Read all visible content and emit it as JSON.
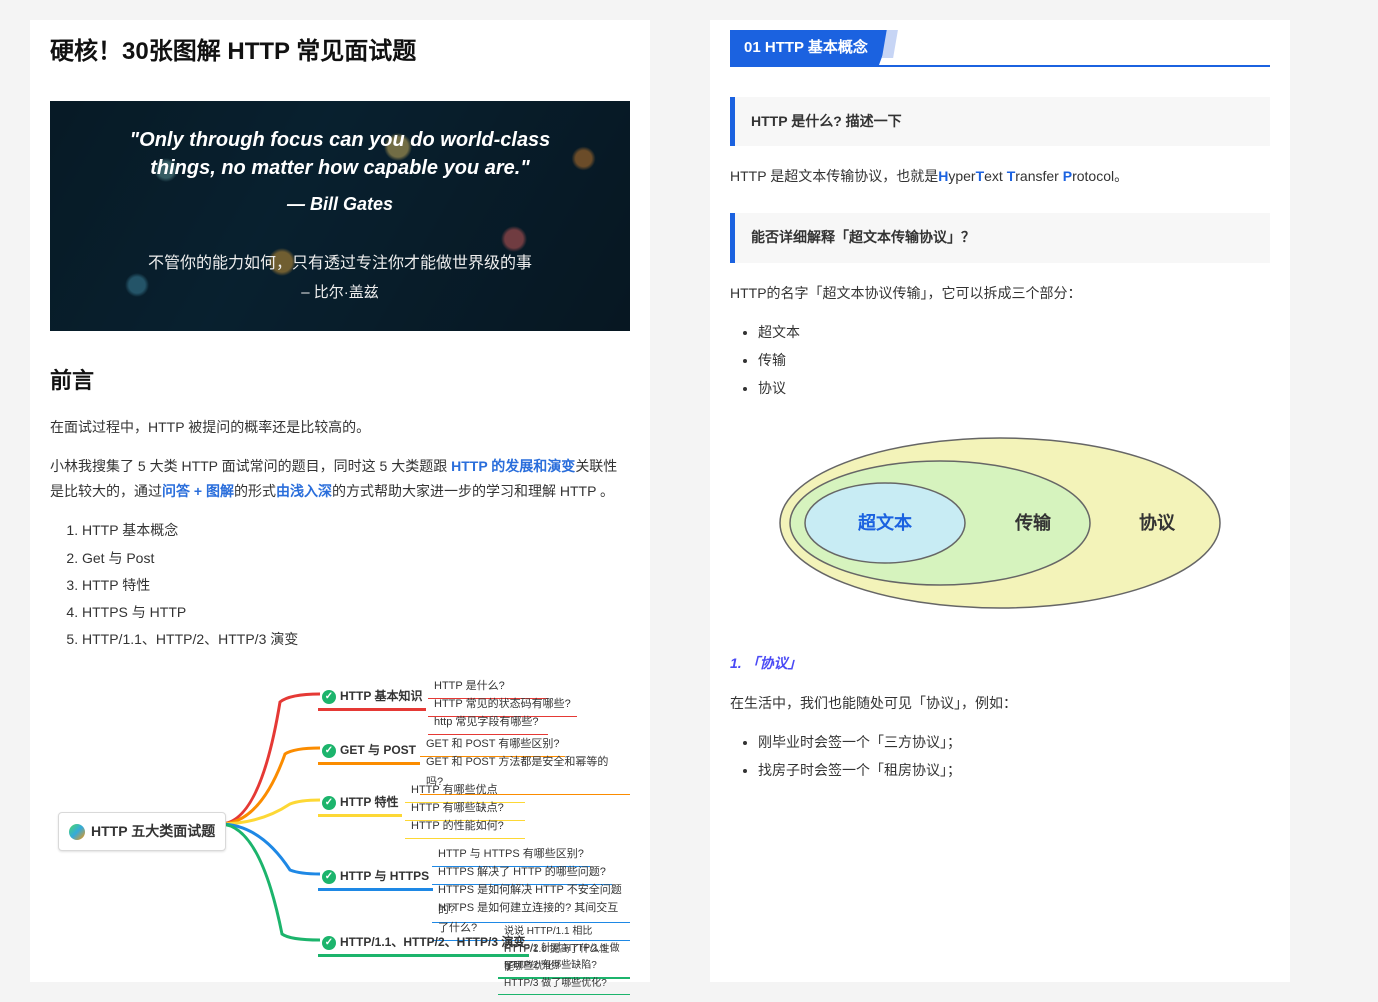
{
  "left": {
    "title": "硬核！30张图解 HTTP 常见面试题",
    "quote": {
      "en": "\"Only through focus can you do world-class things, no matter how capable you are.\"",
      "author_en": "— Bill Gates",
      "cn": "不管你的能力如何，只有透过专注你才能做世界级的事",
      "author_cn": "– 比尔·盖兹"
    },
    "preface_h": "前言",
    "preface_p1": "在面试过程中，HTTP 被提问的概率还是比较高的。",
    "preface_p2a": "小林我搜集了 5 大类 HTTP 面试常问的题目，同时这 5 大类题跟 ",
    "preface_p2b": "HTTP 的发展和演变",
    "preface_p2c": "关联性是比较大的，通过",
    "preface_p2d": "问答 + 图解",
    "preface_p2e": "的形式",
    "preface_p2f": "由浅入深",
    "preface_p2g": "的方式帮助大家进一步的学习和理解 HTTP 。",
    "topics": [
      "HTTP 基本概念",
      "Get 与 Post",
      "HTTP 特性",
      "HTTPS 与 HTTP",
      "HTTP/1.1、HTTP/2、HTTP/3 演变"
    ],
    "mindmap": {
      "root": "HTTP 五大类面试题",
      "branches": [
        {
          "label": "HTTP 基本知识",
          "color": "#e53935",
          "leaves": [
            "HTTP 是什么?",
            "HTTP 常见的状态码有哪些?",
            "http 常见字段有哪些?"
          ]
        },
        {
          "label": "GET 与 POST",
          "color": "#fb8c00",
          "leaves": [
            "GET 和 POST 有哪些区别?",
            "GET 和 POST 方法都是安全和幂等的吗?"
          ]
        },
        {
          "label": "HTTP 特性",
          "color": "#fdd835",
          "leaves": [
            "HTTP 有哪些优点",
            "HTTP 有哪些缺点?",
            "HTTP 的性能如何?"
          ]
        },
        {
          "label": "HTTP 与 HTTPS",
          "color": "#1e88e5",
          "leaves": [
            "HTTP 与 HTTPS 有哪些区别?",
            "HTTPS 解决了 HTTP 的哪些问题?",
            "HTTPS 是如何解决 HTTP 不安全问题的?",
            "HTTPS 是如何建立连接的? 其间交互了什么?"
          ]
        },
        {
          "label": "HTTP/1.1、HTTP/2、HTTP/3 演变",
          "color": "#1cb46c",
          "leaves": [
            "说说 HTTP/1.1 相比 HTTP/1.0 提高了什么性能?",
            "HTTP/2 针对 HTTP/1.1 做了哪些优化?",
            "HTTP/2 有哪些缺陷? HTTP/3 做了哪些优化?"
          ]
        }
      ]
    }
  },
  "right": {
    "section_num": "01",
    "section_title": "HTTP 基本概念",
    "q1": "HTTP 是什么? 描述一下",
    "a1_prefix": "HTTP 是超文本传输协议，也就是",
    "a1_H": "H",
    "a1_yper": "yper",
    "a1_T": "T",
    "a1_ext": "ext ",
    "a1_T2": "T",
    "a1_ransfer": "ransfer ",
    "a1_P": "P",
    "a1_rotocol": "rotocol。",
    "q2": "能否详细解释「超文本传输协议」？",
    "a2_intro": "HTTP的名字「超文本协议传输」，它可以拆成三个部分：",
    "parts": [
      "超文本",
      "传输",
      "协议"
    ],
    "ellipse": {
      "inner": "超文本",
      "mid": "传输",
      "outer": "协议"
    },
    "sub1": "1. 「协议」",
    "sub1_p": "在生活中，我们也能随处可见「协议」，例如：",
    "sub1_items": [
      "刚毕业时会签一个「三方协议」；",
      "找房子时会签一个「租房协议」；"
    ]
  }
}
